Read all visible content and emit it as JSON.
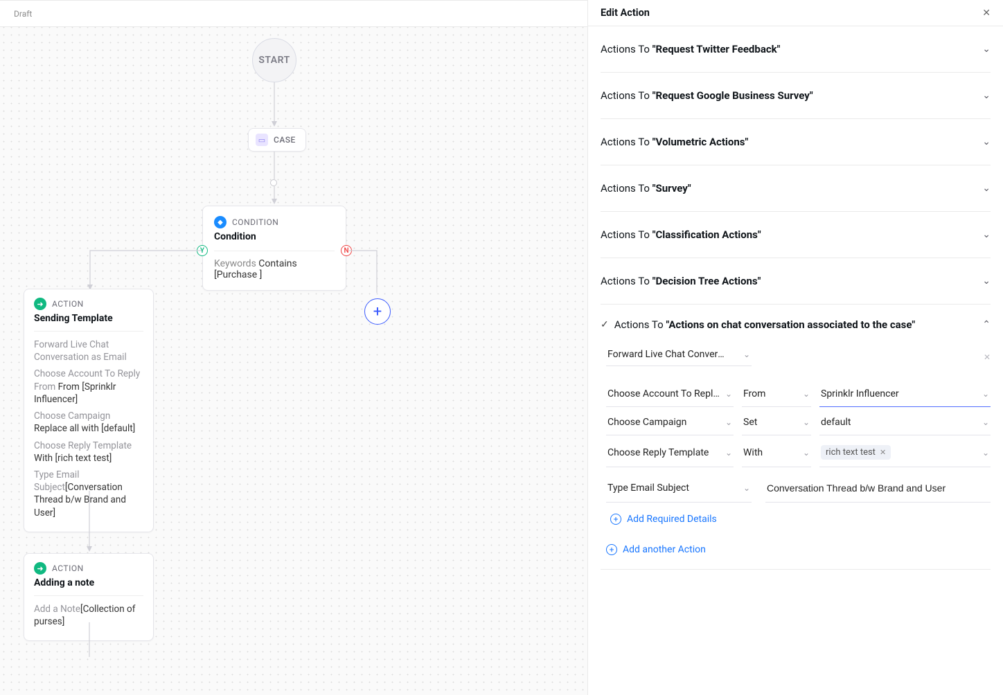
{
  "topbar": {
    "status": "Draft"
  },
  "flow": {
    "start": "START",
    "case": {
      "label": "CASE"
    },
    "condition": {
      "kind": "CONDITION",
      "title": "Condition",
      "keywords_label": "Keywords",
      "op": "Contains",
      "value": "[Purchase ]",
      "yes": "Y",
      "no": "N"
    },
    "action1": {
      "kind": "ACTION",
      "title": "Sending Template",
      "lines": [
        {
          "muted": "Forward Live Chat Conversation as Email",
          "rest": ""
        },
        {
          "muted": "Choose Account To Reply From ",
          "rest": "From [Sprinklr Influencer]"
        },
        {
          "muted": "Choose Campaign ",
          "rest": "Replace all with [default]"
        },
        {
          "muted": "Choose Reply Template ",
          "rest": "With [rich text test]"
        },
        {
          "muted": "Type Email Subject",
          "rest": "[Conversation Thread b/w Brand and User]"
        }
      ]
    },
    "action2": {
      "kind": "ACTION",
      "title": "Adding a note",
      "lines": [
        {
          "muted": "Add a Note",
          "rest": "[Collection of purses]"
        }
      ]
    }
  },
  "panel": {
    "title": "Edit Action",
    "sections": [
      {
        "pre": "Actions To ",
        "bold": "\"Request Twitter Feedback\""
      },
      {
        "pre": "Actions To ",
        "bold": "\"Request Google Business Survey\""
      },
      {
        "pre": "Actions To ",
        "bold": "\"Volumetric Actions\""
      },
      {
        "pre": "Actions To ",
        "bold": "\"Survey\""
      },
      {
        "pre": "Actions To ",
        "bold": "\"Classification Actions\""
      },
      {
        "pre": "Actions To ",
        "bold": "\"Decision Tree Actions\""
      }
    ],
    "active": {
      "pre": "Actions To ",
      "bold": "\"Actions on chat conversation associated to the case\"",
      "primary_select": "Forward Live Chat Conversati…",
      "rows": [
        {
          "a": "Choose Account To Repl…",
          "b": "From",
          "c": "Sprinklr Influencer",
          "accent": true
        },
        {
          "a": "Choose Campaign",
          "b": "Set",
          "c": "default"
        },
        {
          "a": "Choose Reply Template",
          "b": "With",
          "chip": "rich text test"
        }
      ],
      "subject_label": "Type Email Subject",
      "subject_value": "Conversation Thread b/w Brand and User",
      "add_required": "Add Required Details",
      "add_another": "Add another Action"
    }
  }
}
